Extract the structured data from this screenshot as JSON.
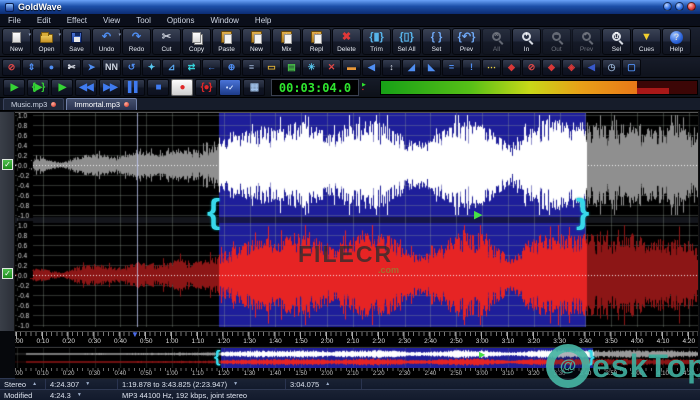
{
  "window": {
    "title": "GoldWave",
    "controls": [
      "minimize",
      "maximize",
      "close"
    ]
  },
  "menu": {
    "items": [
      "File",
      "Edit",
      "Effect",
      "View",
      "Tool",
      "Options",
      "Window",
      "Help"
    ]
  },
  "toolbar_main": {
    "buttons": [
      {
        "label": "New",
        "icon": "page",
        "dd": true
      },
      {
        "label": "Open",
        "icon": "folder",
        "dd": true
      },
      {
        "label": "Save",
        "icon": "floppy"
      },
      {
        "label": "Undo",
        "icon": "g",
        "g": "↶",
        "gc": "#4f8ef2",
        "dd": true
      },
      {
        "label": "Redo",
        "icon": "g",
        "g": "↷",
        "gc": "#4f8ef2"
      },
      {
        "label": "Cut",
        "icon": "g",
        "g": "✂",
        "gc": "#c7ccd6"
      },
      {
        "label": "Copy",
        "icon": "page2"
      },
      {
        "label": "Paste",
        "icon": "clip"
      },
      {
        "label": "New",
        "icon": "clip",
        "ov": "▫"
      },
      {
        "label": "Mix",
        "icon": "clip",
        "ov": "+"
      },
      {
        "label": "Repl",
        "icon": "clip",
        "ov": "✕",
        "ovc": "#c02020"
      },
      {
        "label": "Delete",
        "icon": "g",
        "g": "✖",
        "gc": "#e03838"
      },
      {
        "label": "Trim",
        "icon": "g",
        "g": "{▮}",
        "gc": "#57b4ea"
      },
      {
        "label": "Sel All",
        "icon": "g",
        "g": "{▯}",
        "gc": "#57b4ea"
      },
      {
        "label": "Set",
        "icon": "g",
        "g": "{ }",
        "gc": "#6fa8f5"
      },
      {
        "label": "Prev",
        "icon": "g",
        "g": "{↶}",
        "gc": "#6fa8f5"
      },
      {
        "label": "All",
        "icon": "mag",
        "ov": "✕",
        "grayed": true
      },
      {
        "label": "In",
        "icon": "mag",
        "ov": "+"
      },
      {
        "label": "Out",
        "icon": "mag",
        "ov": "−",
        "grayed": true
      },
      {
        "label": "Prev",
        "icon": "mag",
        "ov": "↶",
        "grayed": true
      },
      {
        "label": "Sel",
        "icon": "mag",
        "ov": "{}"
      },
      {
        "label": "Cues",
        "icon": "g",
        "g": "▼",
        "gc": "#f2cf2e"
      },
      {
        "label": "Help",
        "icon": "help",
        "g": "?"
      }
    ]
  },
  "toolbar_effects": {
    "icons": [
      {
        "n": "disable",
        "g": "⊘",
        "c": "#e04848"
      },
      {
        "n": "doppler",
        "g": "⇕",
        "c": "#4f8ef2"
      },
      {
        "n": "dynamics",
        "g": "●",
        "c": "#4f8ef2"
      },
      {
        "n": "silence",
        "g": "✄",
        "c": "#d8dce4"
      },
      {
        "n": "pitch",
        "g": "➤",
        "c": "#4f8ef2"
      },
      {
        "n": "noise-reduction",
        "g": "NN",
        "c": "#cfd6e2"
      },
      {
        "n": "reverse",
        "g": "↺",
        "c": "#4f8ef2"
      },
      {
        "n": "mechanize",
        "g": "✦",
        "c": "#58c8f0"
      },
      {
        "n": "offset",
        "g": "⊿",
        "c": "#58a8f0"
      },
      {
        "n": "exchange",
        "g": "⇄",
        "c": "#35d0d8"
      },
      {
        "n": "shift-left",
        "g": "←",
        "c": "#4f8ef2"
      },
      {
        "n": "pan",
        "g": "⊕",
        "c": "#4f8ef2"
      },
      {
        "n": "filter",
        "g": "≡",
        "c": "#9fb6d8"
      },
      {
        "n": "parametric-eq",
        "g": "▭",
        "c": "#e8b838"
      },
      {
        "n": "equalizer",
        "g": "▤",
        "c": "#48c048"
      },
      {
        "n": "interpolate",
        "g": "✳",
        "c": "#58c8f0"
      },
      {
        "n": "remove",
        "g": "✕",
        "c": "#e04848"
      },
      {
        "n": "spectrum",
        "g": "▬",
        "c": "#e89838"
      },
      {
        "n": "speaker-left",
        "g": "◀",
        "c": "#4f8ef2"
      },
      {
        "n": "volume",
        "g": "↕",
        "c": "#cfd6e2"
      },
      {
        "n": "fade-in",
        "g": "◢",
        "c": "#4f8ef2"
      },
      {
        "n": "fade-out",
        "g": "◣",
        "c": "#4f8ef2"
      },
      {
        "n": "match-volume",
        "g": "=",
        "c": "#4f8ef2"
      },
      {
        "n": "maximize",
        "g": "!",
        "c": "#4f8ef2"
      },
      {
        "n": "shape",
        "g": "⋯",
        "c": "#e8d048"
      },
      {
        "n": "device",
        "g": "◆",
        "c": "#d83838"
      },
      {
        "n": "mute",
        "g": "⊘",
        "c": "#e04848"
      },
      {
        "n": "cue-point",
        "g": "◆",
        "c": "#d83838"
      },
      {
        "n": "properties",
        "g": "◈",
        "c": "#d83838"
      },
      {
        "n": "control",
        "g": "◀",
        "c": "#3858c8"
      },
      {
        "n": "timer",
        "g": "◷",
        "c": "#8fa8c8"
      },
      {
        "n": "feedback",
        "g": "▢",
        "c": "#4f8ef2"
      }
    ]
  },
  "transport": {
    "buttons": [
      {
        "n": "play",
        "g": "▶",
        "c": "#35d435"
      },
      {
        "n": "play-selection",
        "g": "{▶}",
        "c": "#35d435"
      },
      {
        "n": "play-all",
        "g": "▶",
        "c": "#35d435"
      },
      {
        "n": "rewind",
        "g": "◀◀",
        "c": "#3f7bf0"
      },
      {
        "n": "fast-forward",
        "g": "▶▶",
        "c": "#3f7bf0"
      },
      {
        "n": "pause",
        "g": "▌▌",
        "c": "#3f7bf0"
      },
      {
        "n": "stop",
        "g": "■",
        "c": "#3f7bf0"
      },
      {
        "n": "record",
        "g": "●",
        "c": "#e02828",
        "cls": "rec"
      },
      {
        "n": "record-selection",
        "g": "{●}",
        "c": "#e02828"
      },
      {
        "n": "record-mode",
        "g": "•✓",
        "c": "#cfe0ff",
        "cls": "bluebtn"
      },
      {
        "n": "monitor",
        "g": "▦",
        "c": "#9fc0e8"
      }
    ],
    "time_display": "00:03:04.0"
  },
  "tabs": {
    "items": [
      {
        "label": "Music.mp3",
        "active": false
      },
      {
        "label": "Immortal.mp3",
        "active": true
      }
    ]
  },
  "waveform": {
    "amplitude_labels": [
      "1.0",
      "0.8",
      "0.6",
      "0.4",
      "0.2",
      "0.0",
      "-0.2",
      "-0.4",
      "-0.6",
      "-0.8",
      "-1.0"
    ],
    "envelope": [
      [
        0,
        0.01
      ],
      [
        0.015,
        0.02
      ],
      [
        0.03,
        0.16
      ],
      [
        0.05,
        0.1
      ],
      [
        0.07,
        0.05
      ],
      [
        0.09,
        0.18
      ],
      [
        0.12,
        0.24
      ],
      [
        0.15,
        0.16
      ],
      [
        0.18,
        0.28
      ],
      [
        0.21,
        0.24
      ],
      [
        0.24,
        0.34
      ],
      [
        0.27,
        0.3
      ],
      [
        0.295,
        0.4
      ],
      [
        0.31,
        0.55
      ],
      [
        0.33,
        0.65
      ],
      [
        0.36,
        0.8
      ],
      [
        0.385,
        0.72
      ],
      [
        0.41,
        0.9
      ],
      [
        0.44,
        0.82
      ],
      [
        0.465,
        0.6
      ],
      [
        0.49,
        0.78
      ],
      [
        0.52,
        0.92
      ],
      [
        0.55,
        0.85
      ],
      [
        0.575,
        0.55
      ],
      [
        0.6,
        0.45
      ],
      [
        0.625,
        0.7
      ],
      [
        0.655,
        0.92
      ],
      [
        0.685,
        0.88
      ],
      [
        0.71,
        0.55
      ],
      [
        0.73,
        0.38
      ],
      [
        0.755,
        0.78
      ],
      [
        0.785,
        0.95
      ],
      [
        0.815,
        0.85
      ],
      [
        0.845,
        0.9
      ],
      [
        0.875,
        0.78
      ],
      [
        0.905,
        0.88
      ],
      [
        0.935,
        0.72
      ],
      [
        0.965,
        0.85
      ],
      [
        1,
        0.65
      ]
    ],
    "bracket_open": "{",
    "bracket_close": "}",
    "play_marker": "▶",
    "ruler_marker": "▼"
  },
  "ruler": {
    "labels": [
      "0:00",
      "0:10",
      "0:20",
      "0:30",
      "0:40",
      "0:50",
      "1:00",
      "1:10",
      "1:20",
      "1:30",
      "1:40",
      "1:50",
      "2:00",
      "2:10",
      "2:20",
      "2:30",
      "2:40",
      "2:50",
      "3:00",
      "3:10",
      "3:20",
      "3:30",
      "3:40",
      "3:50",
      "4:00",
      "4:10",
      "4:20"
    ]
  },
  "status_bar": {
    "channels": "Stereo",
    "length": "4:24.307",
    "selection": "1:19.878 to 3:43.825 (2:23.947)",
    "position": "3:04.075",
    "modified": "Modified",
    "total": "4:24.3",
    "format": "MP3 44100 Hz, 192 kbps, joint stereo"
  },
  "watermarks": {
    "filecr": "FILECR",
    "filecr_sub": ".com",
    "desktop_at": "@",
    "desktop_text": "eskTop"
  },
  "colors": {
    "selection_bg": "#1e1e9a",
    "wave_left_selected": "#ffffff",
    "wave_left": "#8f8f8f",
    "wave_right_selected": "#e62424",
    "wave_right": "#8c1616",
    "grid": "rgba(150,160,150,0.33)",
    "time_green": "#2fe62f"
  }
}
